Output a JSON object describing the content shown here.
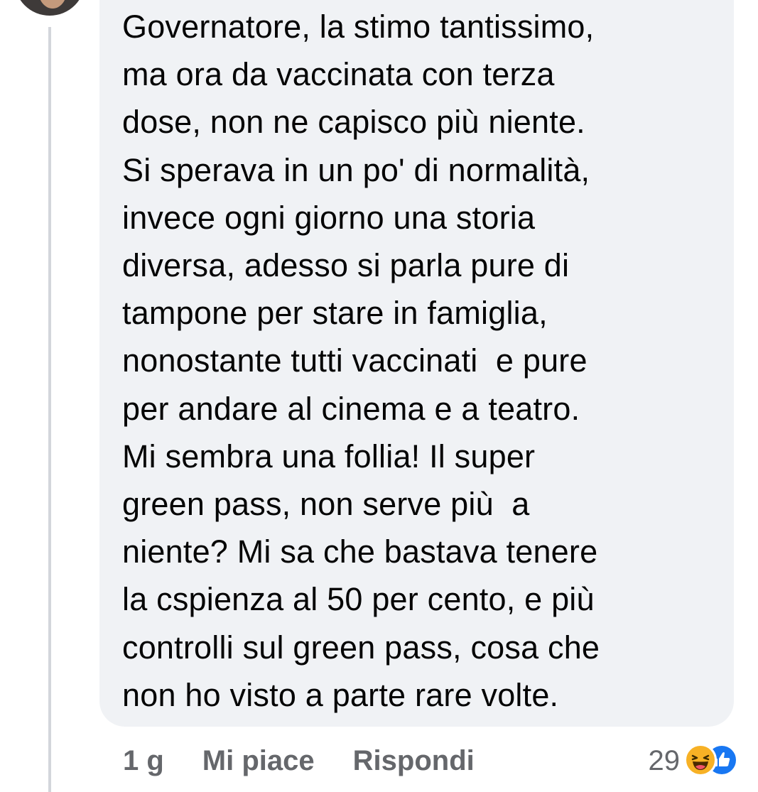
{
  "comment": {
    "text": "Governatore, la stimo tantissimo,\nma ora da vaccinata con terza\ndose, non ne capisco più niente.\nSi sperava in un po' di normalità,\ninvece ogni giorno una storia\ndiversa, adesso si parla pure di\ntampone per stare in famiglia,\nnonostante tutti vaccinati  e pure\nper andare al cinema e a teatro.\nMi sembra una follia! Il super\ngreen pass, non serve più  a\nniente? Mi sa che bastava tenere\nla cspienza al 50 per cento, e più\ncontrolli sul green pass, cosa che\nnon ho visto a parte rare volte."
  },
  "actions": {
    "time": "1 g",
    "like_label": "Mi piace",
    "reply_label": "Rispondi"
  },
  "reactions": {
    "count": "29",
    "icons": [
      "haha-reaction-icon",
      "like-reaction-icon"
    ]
  },
  "colors": {
    "bubble_bg": "#f0f2f5",
    "text": "#050505",
    "secondary_text": "#65676b",
    "like_blue": "#1877f2",
    "haha_yellow": "#f7b125"
  }
}
